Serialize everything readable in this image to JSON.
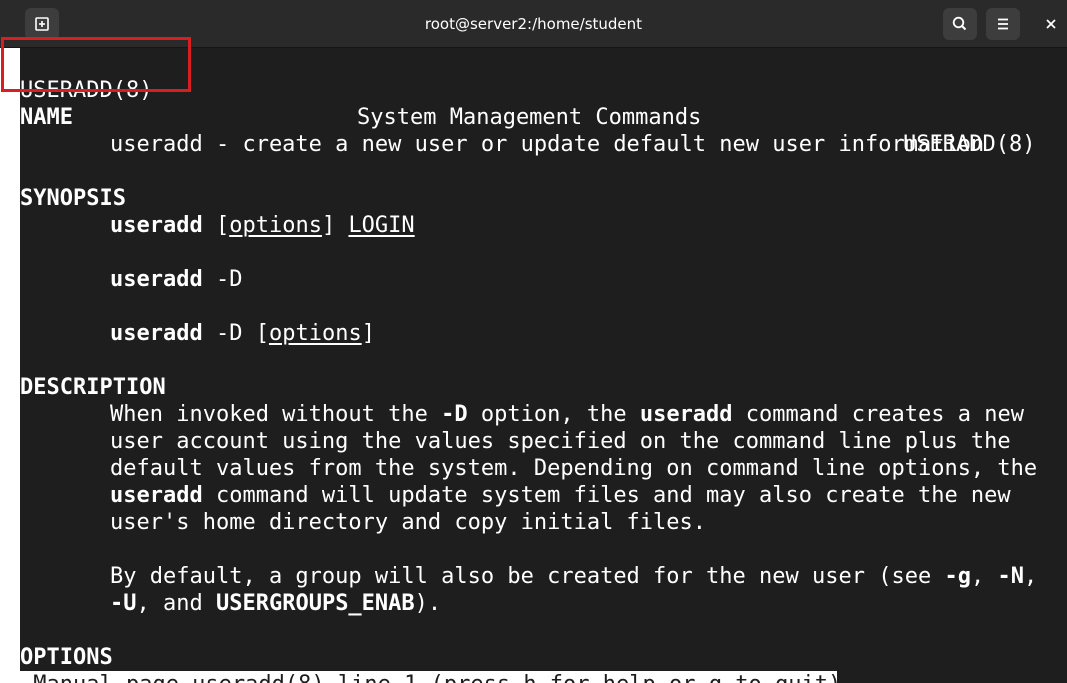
{
  "window": {
    "title": "root@server2:/home/student",
    "buttons": {
      "new_tab": "new-tab-icon",
      "search": "search-icon",
      "menu": "hamburger-menu-icon",
      "close": "close-icon"
    }
  },
  "man": {
    "header": {
      "left": "USERADD(8)",
      "center": "System Management Commands",
      "right": "USERADD(8)"
    },
    "name": {
      "heading": "NAME",
      "text": "useradd - create a new user or update default new user information"
    },
    "synopsis": {
      "heading": "SYNOPSIS",
      "cmd": "useradd",
      "line1": {
        "open": "[",
        "options": "options",
        "close": "]",
        "login": "LOGIN"
      },
      "line2": {
        "flag": "-D"
      },
      "line3": {
        "flag": "-D",
        "open": "[",
        "options": "options",
        "close": "]"
      }
    },
    "description": {
      "heading": "DESCRIPTION",
      "p1": {
        "l1_a": "When invoked without the ",
        "l1_b": "-D",
        "l1_c": " option, the ",
        "l1_d": "useradd",
        "l1_e": " command creates a new",
        "l2": "user account using the values specified on the command line plus the",
        "l3": "default values from the system. Depending on command line options, the",
        "l4_a": "useradd",
        "l4_b": " command will update system files and may also create the new",
        "l5": "user's home directory and copy initial files."
      },
      "p2": {
        "l1_a": "By default, a group will also be created for the new user (see ",
        "l1_b": "-g",
        "l1_c": ", ",
        "l1_d": "-N",
        "l1_e": ",",
        "l2_a": "-U",
        "l2_b": ", and ",
        "l2_c": "USERGROUPS_ENAB",
        "l2_d": ")."
      }
    },
    "options": {
      "heading": "OPTIONS"
    },
    "status": " Manual page useradd(8) line 1 (press h for help or q to quit)"
  },
  "colors": {
    "titlebar": "#2a2a2a",
    "terminal_bg": "#1e1e1e",
    "text": "#ffffff",
    "highlight": "#d81e1e"
  }
}
